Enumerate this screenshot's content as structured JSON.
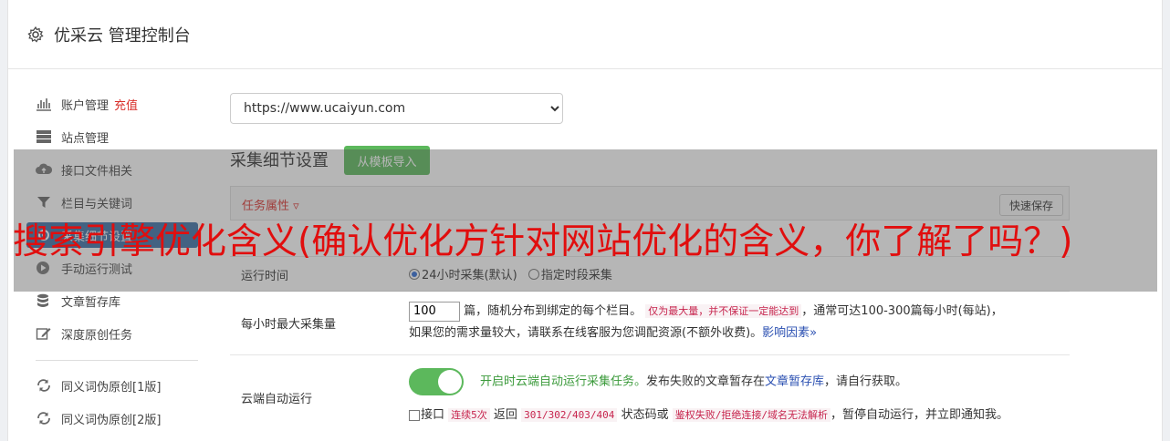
{
  "header": {
    "title": "优采云 管理控制台"
  },
  "sidebar": {
    "items": [
      {
        "label": "账户管理",
        "extra": "充值",
        "icon": "bar-chart-icon"
      },
      {
        "label": "站点管理",
        "icon": "server-icon"
      },
      {
        "label": "接口文件相关",
        "icon": "cloud-upload-icon"
      },
      {
        "label": "栏目与关键词",
        "icon": "filter-icon"
      },
      {
        "label": "采集细节设置",
        "icon": "gear-icon"
      },
      {
        "label": "手动运行测试",
        "icon": "play-icon"
      },
      {
        "label": "文章暂存库",
        "icon": "database-icon"
      },
      {
        "label": "深度原创任务",
        "icon": "edit-icon"
      },
      {
        "label": "同义词伪原创[1版]",
        "icon": "refresh-icon"
      },
      {
        "label": "同义词伪原创[2版]",
        "icon": "refresh-icon"
      }
    ]
  },
  "main": {
    "site_select": {
      "value": "https://www.ucaiyun.com"
    },
    "section_title": "采集细节设置",
    "import_button": "从模板导入",
    "panel": {
      "task_attr": "任务属性 ▿",
      "quick_save": "快速保存"
    },
    "rows": {
      "run_time": {
        "label": "运行时间",
        "opt1": "24小时采集(默认)",
        "opt2": "指定时段采集"
      },
      "max_per_hour": {
        "label": "每小时最大采集量",
        "value": "100",
        "text1": "篇，随机分布到绑定的每个栏目。",
        "note": "仅为最大量，并不保证一定能达到",
        "text2": "，通常可达100-300篇每小时(每站)，",
        "text3": "如果您的需求量较大，请联系在线客服为您调配资源(不额外收费)。",
        "link": "影响因素»"
      },
      "auto_run": {
        "label": "云端自动运行",
        "on_text": "开启时云端自动运行采集任务。",
        "text1": "发布失败的文章暂存在",
        "link": "文章暂存库",
        "text2": "，请自行获取。",
        "chk_label": "接口",
        "code1": "连续5次",
        "text3": "返回",
        "code2": "301/302/403/404",
        "text4": "状态码或",
        "code3": "鉴权失败/拒绝连接/域名无法解析",
        "text5": "，暂停自动运行，并立即通知我。"
      }
    }
  },
  "overlay": {
    "text": "搜索引擎优化含义(确认优化方针对网站优化的含义，你了解了吗？)"
  },
  "colors": {
    "accent": "#3a6ea5",
    "success": "#5cb85c",
    "danger": "#d9302b",
    "overlay_text": "#e10e0e"
  }
}
